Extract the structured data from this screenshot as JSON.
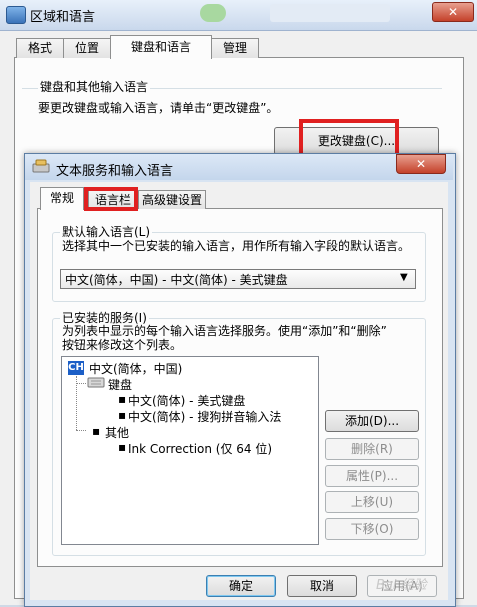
{
  "outer": {
    "title": "区域和语言",
    "tabs": [
      {
        "label": "格式"
      },
      {
        "label": "位置"
      },
      {
        "label": "键盘和语言"
      },
      {
        "label": "管理"
      }
    ],
    "group_title": "键盘和其他输入语言",
    "group_desc": "要更改键盘或输入语言，请单击“更改键盘”。",
    "change_keyboard_button": "更改键盘(C)...",
    "close_glyph": "✕"
  },
  "dialog": {
    "title": "文本服务和输入语言",
    "close_glyph": "✕",
    "tabs": [
      {
        "label": "常规"
      },
      {
        "label": "语言栏"
      },
      {
        "label": "高级键设置"
      }
    ],
    "default_lang": {
      "group_title": "默认输入语言(L)",
      "desc": "选择其中一个已安装的输入语言，用作所有输入字段的默认语言。",
      "selected": "中文(简体，中国) - 中文(简体) - 美式键盘"
    },
    "installed": {
      "group_title": "已安装的服务(I)",
      "desc_line1": "为列表中显示的每个输入语言选择服务。使用“添加”和“删除”",
      "desc_line2": "按钮来修改这个列表。",
      "tree": {
        "lang_badge": "CH",
        "lang": "中文(简体，中国)",
        "keyboard_label": "键盘",
        "keyboard_items": [
          "中文(简体) - 美式键盘",
          "中文(简体) - 搜狗拼音输入法"
        ],
        "other_label": "其他",
        "other_items": [
          "Ink Correction (仅 64 位)"
        ]
      },
      "buttons": {
        "add": "添加(D)...",
        "remove": "删除(R)",
        "properties": "属性(P)...",
        "move_up": "上移(U)",
        "move_down": "下移(O)"
      }
    },
    "footer": {
      "ok": "确定",
      "cancel": "取消",
      "apply": "应用(A)"
    }
  },
  "watermark": "Bai 经验",
  "colors": {
    "highlight_red": "#e02020",
    "accent_blue": "#1c5fc7"
  }
}
